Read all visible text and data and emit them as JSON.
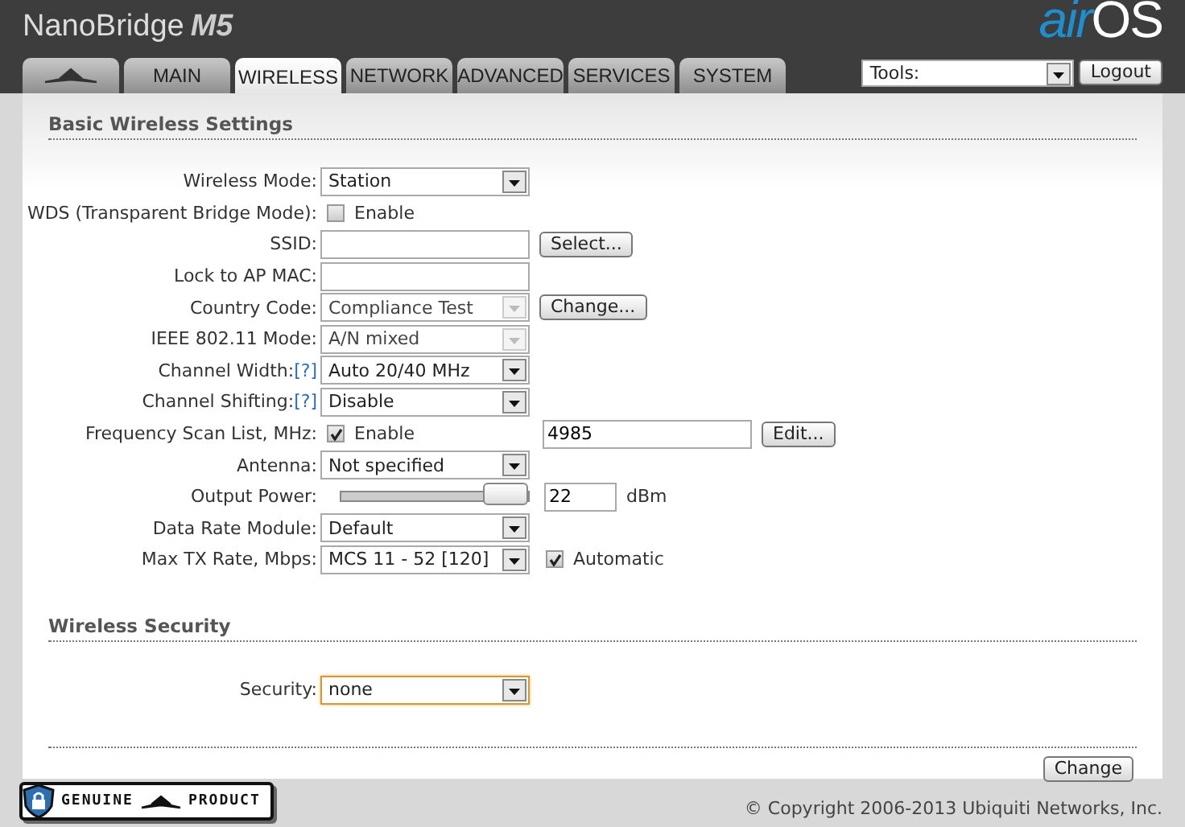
{
  "header": {
    "title": "NanoBridge",
    "model": "M5",
    "logo": [
      "air",
      "OS"
    ]
  },
  "tabs": [
    {
      "kind": "icon",
      "selected": false
    },
    {
      "kind": "text",
      "label": "MAIN",
      "selected": false
    },
    {
      "kind": "text",
      "label": "WIRELESS",
      "selected": true
    },
    {
      "kind": "text",
      "label": "NETWORK",
      "selected": false
    },
    {
      "kind": "text",
      "label": "ADVANCED",
      "selected": false
    },
    {
      "kind": "text",
      "label": "SERVICES",
      "selected": false
    },
    {
      "kind": "text",
      "label": "SYSTEM",
      "selected": false
    }
  ],
  "tools": {
    "select": "Tools:",
    "button": "Logout"
  },
  "sections": [
    {
      "title": "Basic Wireless Settings",
      "rows": [
        {
          "label": "Wireless Mode:",
          "controls": [
            {
              "kind": "select",
              "value": "Station",
              "disabled": false,
              "focused": false
            }
          ]
        },
        {
          "label": "WDS (Transparent Bridge Mode):",
          "controls": [
            {
              "kind": "checkbox",
              "checked": false,
              "label": "Enable"
            }
          ]
        },
        {
          "label": "SSID:",
          "controls": [
            {
              "kind": "text"
            },
            {
              "kind": "button",
              "label": "Select..."
            }
          ]
        },
        {
          "label": "Lock to AP MAC:",
          "controls": [
            {
              "kind": "text"
            }
          ]
        },
        {
          "label": "Country Code:",
          "controls": [
            {
              "kind": "select",
              "value": "Compliance Test",
              "disabled": true,
              "focused": false
            },
            {
              "kind": "button",
              "label": "Change..."
            }
          ]
        },
        {
          "label": "IEEE 802.11 Mode:",
          "controls": [
            {
              "kind": "select",
              "value": "A/N mixed",
              "disabled": true,
              "focused": false
            }
          ]
        },
        {
          "label": "Channel Width:",
          "help": "[?]",
          "controls": [
            {
              "kind": "select",
              "value": "Auto 20/40 MHz",
              "disabled": false,
              "focused": false
            }
          ]
        },
        {
          "label": "Channel Shifting:",
          "help": "[?]",
          "controls": [
            {
              "kind": "select",
              "value": "Disable",
              "disabled": false,
              "focused": false
            }
          ]
        },
        {
          "label": "Frequency Scan List, MHz:",
          "controls": [
            {
              "kind": "checkbox",
              "checked": true,
              "label": "Enable"
            },
            {
              "kind": "text",
              "value": "4985"
            },
            {
              "kind": "button",
              "label": "Edit..."
            }
          ]
        },
        {
          "label": "Antenna:",
          "controls": [
            {
              "kind": "select",
              "value": "Not specified",
              "disabled": false,
              "focused": false
            }
          ]
        },
        {
          "label": "Output Power:",
          "controls": [
            {
              "kind": "slider",
              "level": 1
            },
            {
              "kind": "text",
              "value": "22"
            },
            {
              "kind": "unit",
              "label": "dBm"
            }
          ]
        },
        {
          "label": "Data Rate Module:",
          "controls": [
            {
              "kind": "select",
              "value": "Default",
              "disabled": false,
              "focused": false
            }
          ]
        },
        {
          "label": "Max TX Rate, Mbps:",
          "controls": [
            {
              "kind": "select",
              "value": "MCS 11 - 52 [120]",
              "disabled": false,
              "focused": false
            },
            {
              "kind": "checkbox",
              "checked": true,
              "label": "Automatic"
            }
          ]
        }
      ]
    },
    {
      "title": "Wireless Security",
      "rows": [
        {
          "label": "Security:",
          "controls": [
            {
              "kind": "select",
              "value": "none",
              "disabled": false,
              "focused": true
            }
          ]
        }
      ]
    }
  ],
  "submit": "Change",
  "footer": {
    "badge": [
      "GENUINE",
      "PRODUCT"
    ],
    "copyright": "© Copyright 2006-2013 Ubiquiti Networks, Inc."
  }
}
